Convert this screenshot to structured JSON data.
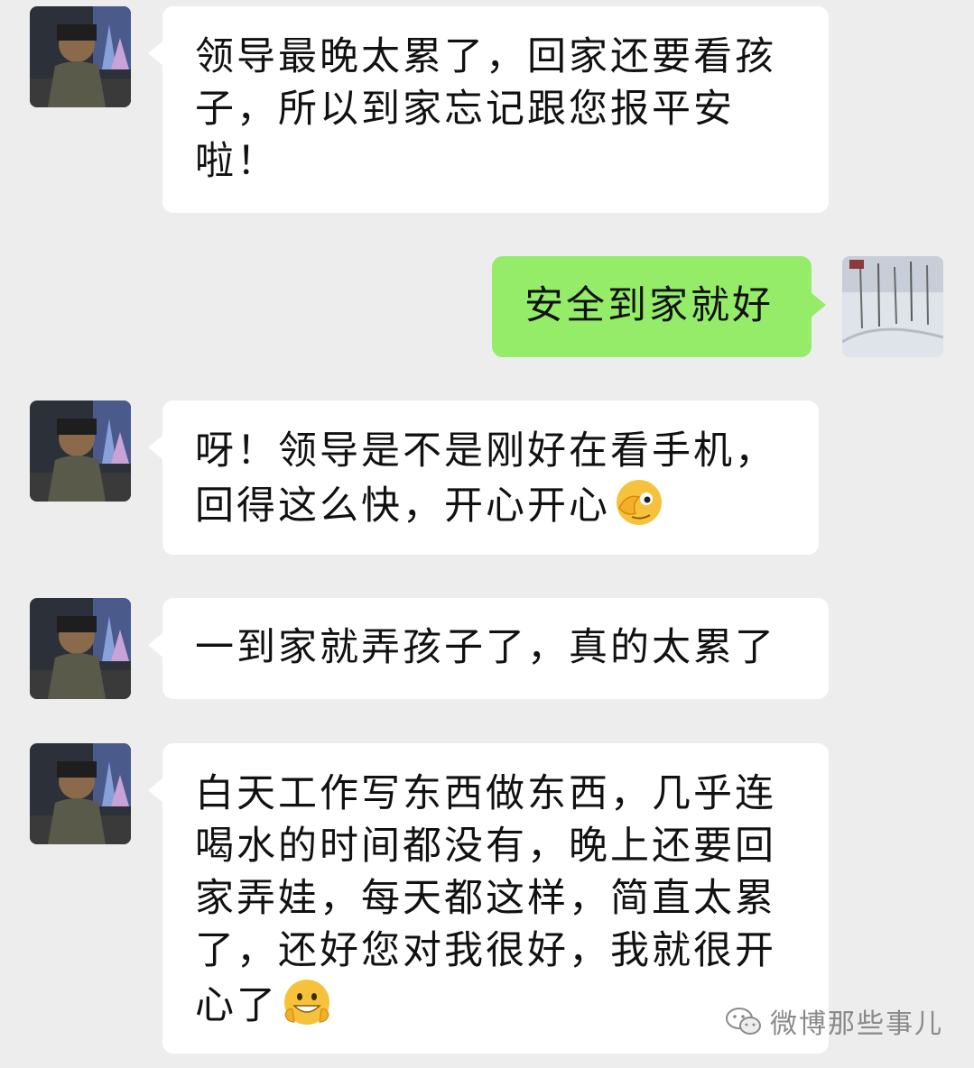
{
  "messages": [
    {
      "side": "left",
      "avatar": "contact-avatar",
      "text": "领导最晚太累了，回家还要看孩子，所以到家忘记跟您报平安啦！"
    },
    {
      "side": "right",
      "avatar": "self-avatar",
      "text": "安全到家就好"
    },
    {
      "side": "left",
      "avatar": "contact-avatar",
      "text": "呀！领导是不是刚好在看手机，回得这么快，开心开心",
      "emoji": "facepalm-peek-emoji"
    },
    {
      "side": "left",
      "avatar": "contact-avatar",
      "text": "一到家就弄孩子了，真的太累了"
    },
    {
      "side": "left",
      "avatar": "contact-avatar",
      "text": "白天工作写东西做东西，几乎连喝水的时间都没有，晚上还要回家弄娃，每天都这样，简直太累了，还好您对我很好，我就很开心了",
      "emoji": "grin-emoji"
    }
  ],
  "watermark": {
    "icon": "wechat-icon",
    "text": "微博那些事儿"
  },
  "colors": {
    "background": "#ededed",
    "incoming_bubble": "#ffffff",
    "outgoing_bubble": "#95ec69"
  }
}
